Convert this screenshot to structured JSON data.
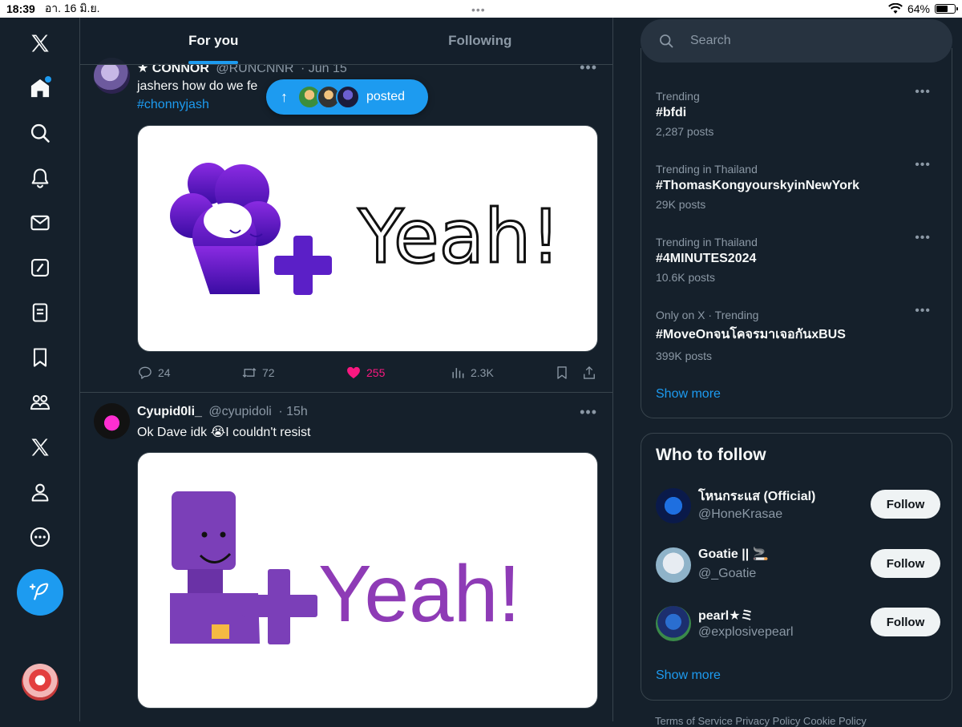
{
  "status_bar": {
    "time": "18:39",
    "date": "อา. 16 มิ.ย.",
    "battery": "64%",
    "battery_level": 0.64
  },
  "nav": {
    "items": [
      "x-logo",
      "home",
      "explore",
      "notifications",
      "messages",
      "grok",
      "lists",
      "bookmarks",
      "communities",
      "premium",
      "profile",
      "more"
    ],
    "home_has_badge": true
  },
  "tabs": [
    {
      "label": "For you",
      "active": true
    },
    {
      "label": "Following",
      "active": false
    }
  ],
  "new_posts_pill": {
    "label": "posted"
  },
  "posts": [
    {
      "name": "★ CONNOR",
      "handle": "@RUNCNNR",
      "time": "· Jun 15",
      "text": "jashers how do we fe",
      "hashtag": "#chonnyjash",
      "image_text": "Yeah!",
      "replies": "24",
      "reposts": "72",
      "likes": "255",
      "liked": true,
      "views": "2.3K"
    },
    {
      "name": "Cyupid0li_",
      "handle": "@cyupidoli",
      "time": "· 15h",
      "text": "Ok Dave idk 😭I couldn't resist",
      "image_text": "Yeah!"
    }
  ],
  "search": {
    "placeholder": "Search"
  },
  "trends": [
    {
      "meta": "Trending",
      "tag": "#bfdi",
      "count": "2,287 posts"
    },
    {
      "meta": "Trending in Thailand",
      "tag": "#ThomasKongyourskyinNewYork",
      "count": "29K posts"
    },
    {
      "meta": "Trending in Thailand",
      "tag": "#4MINUTES2024",
      "count": "10.6K posts"
    },
    {
      "meta": "Only on X · Trending",
      "tag": "#MoveOnจนโคจรมาเจอกันxBUS",
      "count": "399K posts"
    }
  ],
  "trends_show_more": "Show more",
  "who_to_follow": {
    "title": "Who to follow",
    "accounts": [
      {
        "name": "โหนกระแส (Official)",
        "handle": "@HoneKrasae",
        "button": "Follow"
      },
      {
        "name": "Goatie || 🚬",
        "handle": "@_Goatie",
        "button": "Follow"
      },
      {
        "name": "pearl★ミ",
        "handle": "@explosivepearl",
        "button": "Follow"
      }
    ],
    "show_more": "Show more"
  },
  "footer": "Terms of Service   Privacy Policy   Cookie Policy",
  "colors": {
    "background": "#15202b",
    "accent": "#1d9bf0",
    "like": "#f91880",
    "border": "#38444d",
    "muted": "#8b98a5"
  }
}
